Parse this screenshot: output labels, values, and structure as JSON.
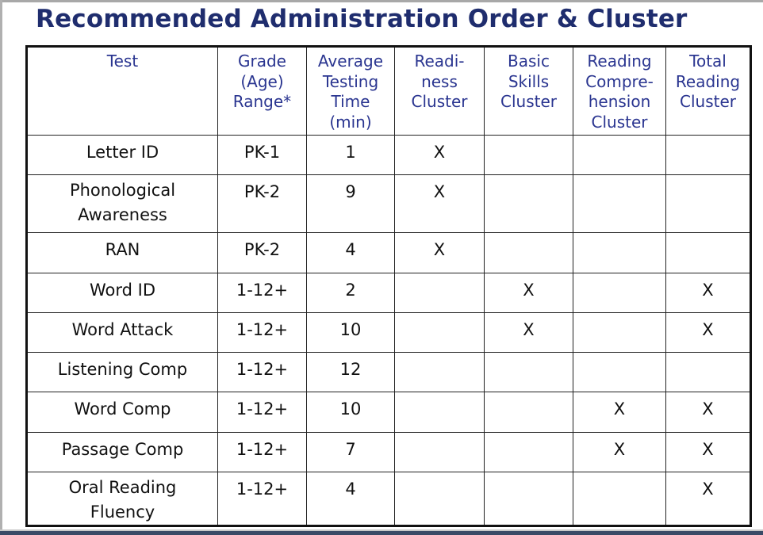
{
  "title": "Recommended Administration Order & Cluster",
  "table": {
    "headers": [
      {
        "key": "test",
        "label": "Test"
      },
      {
        "key": "grade",
        "label": "Grade (Age) Range*",
        "lines": [
          "Grade",
          "(Age)",
          "Range*"
        ]
      },
      {
        "key": "time",
        "label": "Average Testing Time (min)",
        "lines": [
          "Average",
          "Testing",
          "Time",
          "(min)"
        ]
      },
      {
        "key": "readiness",
        "label": "Readiness Cluster",
        "lines": [
          "Readi-",
          "ness",
          "Cluster"
        ]
      },
      {
        "key": "basic",
        "label": "Basic Skills Cluster",
        "lines": [
          "Basic",
          "Skills",
          "Cluster"
        ]
      },
      {
        "key": "comprehension",
        "label": "Reading Comprehension Cluster",
        "lines": [
          "Reading",
          "Compre-",
          "hension",
          "Cluster"
        ]
      },
      {
        "key": "total",
        "label": "Total Reading Cluster",
        "lines": [
          "Total",
          "Reading",
          "Cluster"
        ]
      }
    ],
    "check_mark": "X",
    "rows": [
      {
        "test": "Letter ID",
        "test_lines": [
          "Letter ID"
        ],
        "grade": "PK-1",
        "time": "1",
        "readiness": "X",
        "basic": "",
        "comprehension": "",
        "total": ""
      },
      {
        "test": "Phonological Awareness",
        "test_lines": [
          "Phonological",
          "Awareness"
        ],
        "grade": "PK-2",
        "time": "9",
        "readiness": "X",
        "basic": "",
        "comprehension": "",
        "total": ""
      },
      {
        "test": "RAN",
        "test_lines": [
          "RAN"
        ],
        "grade": "PK-2",
        "time": "4",
        "readiness": "X",
        "basic": "",
        "comprehension": "",
        "total": ""
      },
      {
        "test": "Word ID",
        "test_lines": [
          "Word ID"
        ],
        "grade": "1-12+",
        "time": "2",
        "readiness": "",
        "basic": "X",
        "comprehension": "",
        "total": "X"
      },
      {
        "test": "Word Attack",
        "test_lines": [
          "Word Attack"
        ],
        "grade": "1-12+",
        "time": "10",
        "readiness": "",
        "basic": "X",
        "comprehension": "",
        "total": "X"
      },
      {
        "test": "Listening Comp",
        "test_lines": [
          "Listening Comp"
        ],
        "grade": "1-12+",
        "time": "12",
        "readiness": "",
        "basic": "",
        "comprehension": "",
        "total": ""
      },
      {
        "test": "Word Comp",
        "test_lines": [
          "Word Comp"
        ],
        "grade": "1-12+",
        "time": "10",
        "readiness": "",
        "basic": "",
        "comprehension": "X",
        "total": "X"
      },
      {
        "test": "Passage Comp",
        "test_lines": [
          "Passage Comp"
        ],
        "grade": "1-12+",
        "time": "7",
        "readiness": "",
        "basic": "",
        "comprehension": "X",
        "total": "X"
      },
      {
        "test": "Oral Reading Fluency",
        "test_lines": [
          "Oral Reading",
          "Fluency"
        ],
        "grade": "1-12+",
        "time": "4",
        "readiness": "",
        "basic": "",
        "comprehension": "",
        "total": "X"
      }
    ]
  }
}
